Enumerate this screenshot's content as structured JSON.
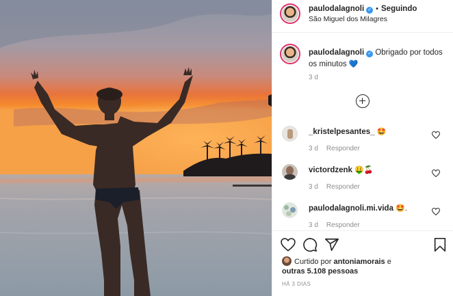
{
  "post": {
    "author": "paulodalagnoli",
    "follow_label": "Seguindo",
    "location": "São Miguel dos Milagres",
    "caption_text": "Obrigado por todos os minutos",
    "caption_emoji": "💙",
    "caption_time": "3 d"
  },
  "comments": [
    {
      "user": "_kristelpesantes_",
      "text": "🤩",
      "time": "3 d",
      "reply": "Responder"
    },
    {
      "user": "victordzenk",
      "text": "🤑🍒",
      "time": "3 d",
      "reply": "Responder"
    },
    {
      "user": "paulodalagnoli.mi.vida",
      "text": "🤩.",
      "time": "3 d",
      "reply": "Responder"
    }
  ],
  "likes": {
    "prefix": "Curtido por",
    "user": "antoniamorais",
    "joiner": "e",
    "others": "outras 5.108 pessoas"
  },
  "posted_ago": "HÁ 3 DIAS",
  "icons": {
    "like": "heart-outline-icon",
    "comment": "speech-bubble-icon",
    "share": "paper-plane-icon",
    "save": "bookmark-icon",
    "more": "plus-circle-icon"
  },
  "colors": {
    "verified": "#3897f0",
    "text": "#262626",
    "muted": "#8e8e8e",
    "border": "#efefef"
  }
}
